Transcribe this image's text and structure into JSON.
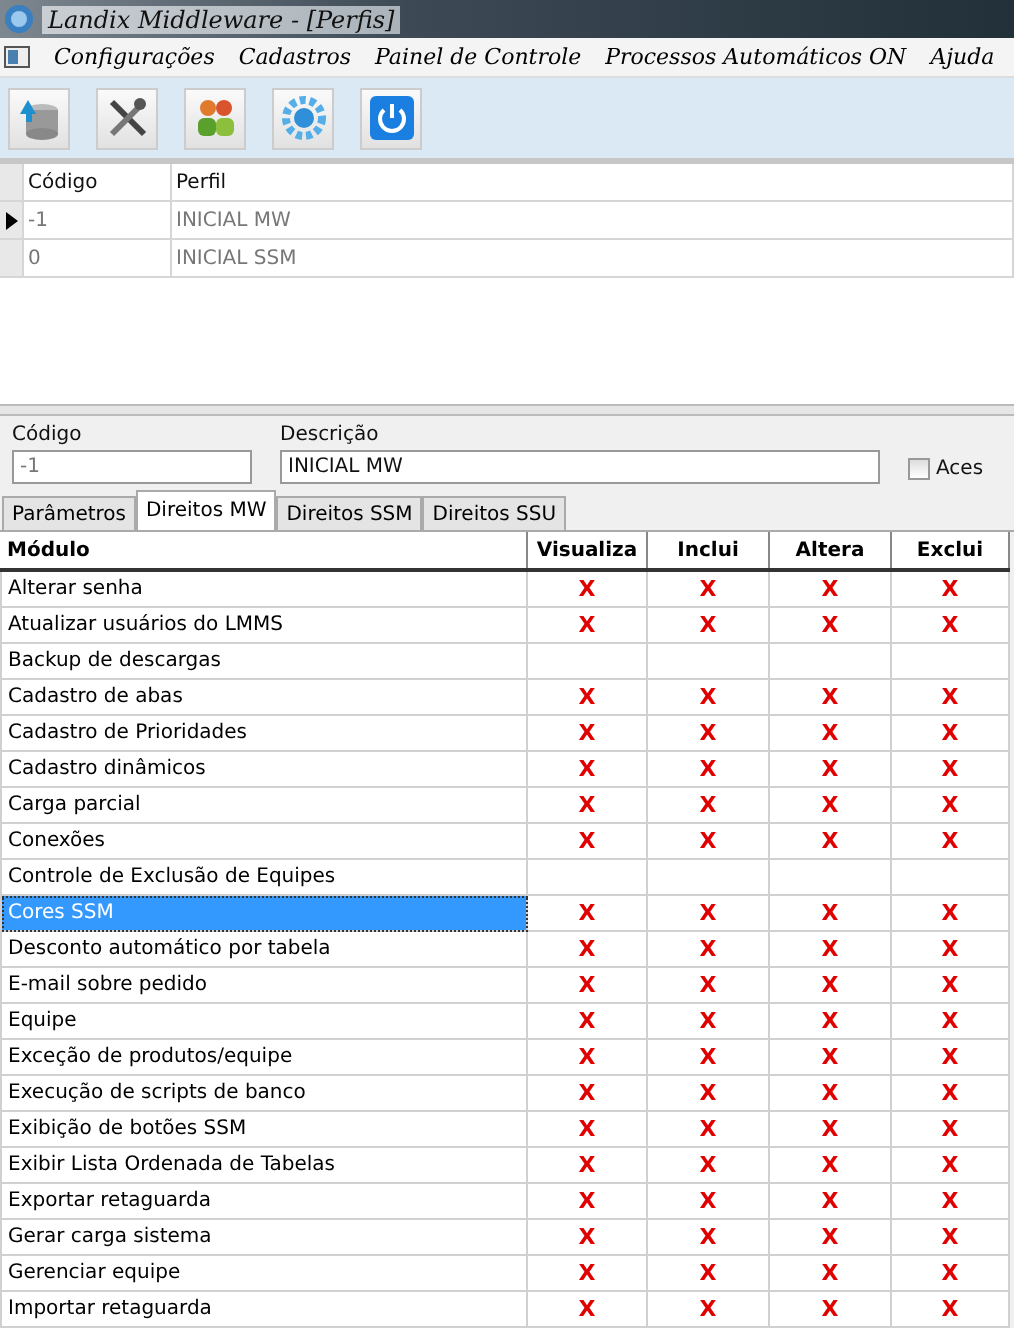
{
  "window": {
    "title": "Landix Middleware - [Perfis]"
  },
  "menu": [
    "Configurações",
    "Cadastros",
    "Painel de Controle",
    "Processos Automáticos ON",
    "Ajuda"
  ],
  "toolbar": [
    {
      "kind": "database"
    },
    {
      "kind": "tools"
    },
    {
      "kind": "people"
    },
    {
      "kind": "gear"
    },
    {
      "kind": "power"
    }
  ],
  "profiles": {
    "columns": [
      "Código",
      "Perfil"
    ],
    "rows": [
      {
        "codigo": "-1",
        "perfil": "INICIAL MW",
        "current": true
      },
      {
        "codigo": "0",
        "perfil": "INICIAL SSM",
        "current": false
      }
    ]
  },
  "form": {
    "codigo_label": "Código",
    "codigo_value": "-1",
    "descricao_label": "Descrição",
    "descricao_value": "INICIAL MW",
    "checkbox_label": "Aces",
    "checkbox_checked": false
  },
  "tabs": [
    {
      "label": "Parâmetros",
      "selected": false
    },
    {
      "label": "Direitos MW",
      "selected": true
    },
    {
      "label": "Direitos SSM",
      "selected": false
    },
    {
      "label": "Direitos SSU",
      "selected": false
    }
  ],
  "rights": {
    "columns": [
      "Módulo",
      "Visualiza",
      "Inclui",
      "Altera",
      "Exclui"
    ],
    "rows": [
      {
        "module": "Alterar senha",
        "selected": false,
        "marks": [
          "X",
          "X",
          "X",
          "X"
        ]
      },
      {
        "module": "Atualizar usuários do LMMS",
        "selected": false,
        "marks": [
          "X",
          "X",
          "X",
          "X"
        ]
      },
      {
        "module": "Backup de descargas",
        "selected": false
      },
      {
        "module": "Cadastro de abas",
        "selected": false,
        "marks": [
          "X",
          "X",
          "X",
          "X"
        ]
      },
      {
        "module": "Cadastro de Prioridades",
        "selected": false,
        "marks": [
          "X",
          "X",
          "X",
          "X"
        ]
      },
      {
        "module": "Cadastro dinâmicos",
        "selected": false,
        "marks": [
          "X",
          "X",
          "X",
          "X"
        ]
      },
      {
        "module": "Carga parcial",
        "selected": false,
        "marks": [
          "X",
          "X",
          "X",
          "X"
        ]
      },
      {
        "module": "Conexões",
        "selected": false,
        "marks": [
          "X",
          "X",
          "X",
          "X"
        ]
      },
      {
        "module": "Controle de Exclusão de Equipes",
        "selected": false
      },
      {
        "module": "Cores SSM",
        "selected": true,
        "marks": [
          "X",
          "X",
          "X",
          "X"
        ]
      },
      {
        "module": "Desconto automático por tabela",
        "selected": false,
        "marks": [
          "X",
          "X",
          "X",
          "X"
        ]
      },
      {
        "module": "E-mail sobre pedido",
        "selected": false,
        "marks": [
          "X",
          "X",
          "X",
          "X"
        ]
      },
      {
        "module": "Equipe",
        "selected": false,
        "marks": [
          "X",
          "X",
          "X",
          "X"
        ]
      },
      {
        "module": "Exceção de produtos/equipe",
        "selected": false,
        "marks": [
          "X",
          "X",
          "X",
          "X"
        ]
      },
      {
        "module": "Execução de scripts de banco",
        "selected": false,
        "marks": [
          "X",
          "X",
          "X",
          "X"
        ]
      },
      {
        "module": "Exibição de botões SSM",
        "selected": false,
        "marks": [
          "X",
          "X",
          "X",
          "X"
        ]
      },
      {
        "module": "Exibir Lista Ordenada de Tabelas",
        "selected": false,
        "marks": [
          "X",
          "X",
          "X",
          "X"
        ]
      },
      {
        "module": "Exportar retaguarda",
        "selected": false,
        "marks": [
          "X",
          "X",
          "X",
          "X"
        ]
      },
      {
        "module": "Gerar carga sistema",
        "selected": false,
        "marks": [
          "X",
          "X",
          "X",
          "X"
        ]
      },
      {
        "module": "Gerenciar equipe",
        "selected": false,
        "marks": [
          "X",
          "X",
          "X",
          "X"
        ]
      },
      {
        "module": "Importar retaguarda",
        "selected": false,
        "marks": [
          "X",
          "X",
          "X",
          "X"
        ]
      }
    ]
  }
}
